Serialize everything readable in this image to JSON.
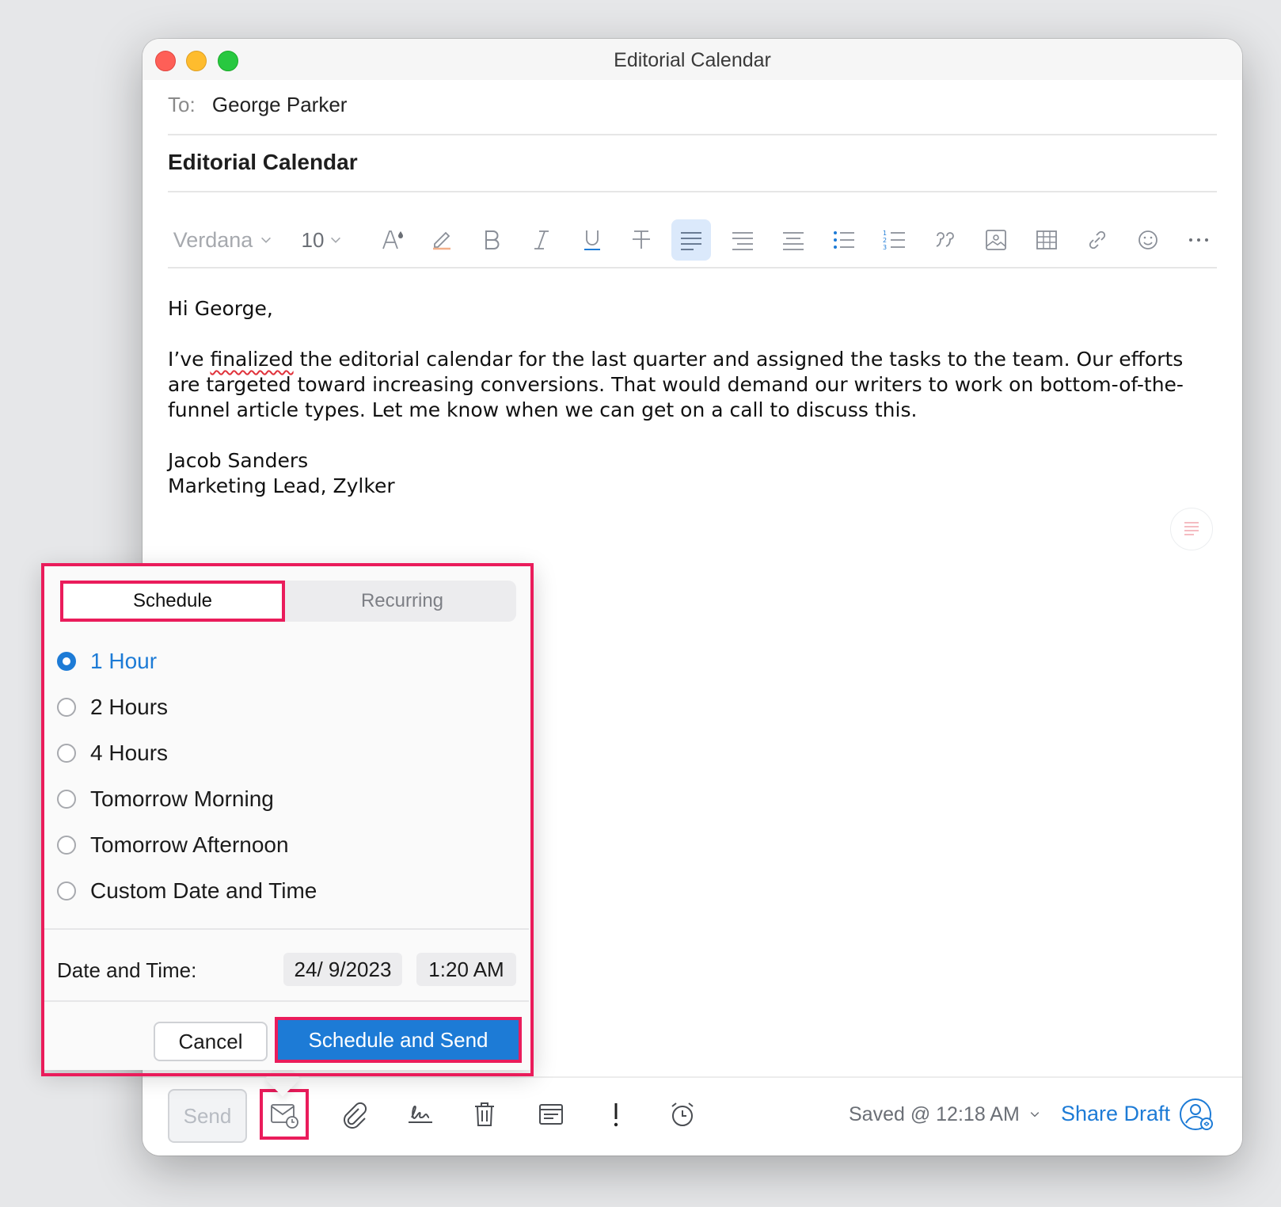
{
  "window": {
    "title": "Editorial Calendar"
  },
  "compose": {
    "to_label": "To:",
    "to_value": "George Parker",
    "subject": "Editorial Calendar"
  },
  "toolbar": {
    "font": "Verdana",
    "size": "10",
    "icons": [
      "font-color-icon",
      "highlight-icon",
      "bold-icon",
      "italic-icon",
      "underline-icon",
      "strikethrough-icon",
      "align-left-icon",
      "align-center-icon",
      "align-right-icon",
      "bullet-list-icon",
      "numbered-list-icon",
      "quote-icon",
      "image-icon",
      "table-icon",
      "link-icon",
      "emoji-icon",
      "more-icon"
    ]
  },
  "body": {
    "greeting": "Hi George,",
    "para_1": "I’ve ",
    "para_misspelled": "finalized",
    "para_2": " the editorial calendar for the last quarter and assigned the tasks to the team. Our efforts are targeted toward increasing conversions. That would demand our writers to work on bottom-of-the-funnel article types. Let me know when we can get on a call to discuss this.",
    "sig_name": "Jacob Sanders",
    "sig_title": "Marketing Lead, Zylker"
  },
  "schedule_popover": {
    "tabs": {
      "schedule": "Schedule",
      "recurring": "Recurring",
      "active": "Schedule"
    },
    "options": [
      {
        "label": "1 Hour",
        "selected": true
      },
      {
        "label": "2 Hours",
        "selected": false
      },
      {
        "label": "4 Hours",
        "selected": false
      },
      {
        "label": "Tomorrow Morning",
        "selected": false
      },
      {
        "label": "Tomorrow Afternoon",
        "selected": false
      },
      {
        "label": "Custom Date and Time",
        "selected": false
      }
    ],
    "datetime_label": "Date and Time:",
    "date_value": "24/ 9/2023",
    "time_value": "1:20 AM",
    "cancel_label": "Cancel",
    "confirm_label": "Schedule and Send"
  },
  "bottom_bar": {
    "send_label": "Send",
    "saved_status": "Saved @ 12:18 AM",
    "share_label": "Share Draft"
  },
  "colors": {
    "accent": "#1d7bd6",
    "highlight_outline": "#ea1c5b"
  }
}
